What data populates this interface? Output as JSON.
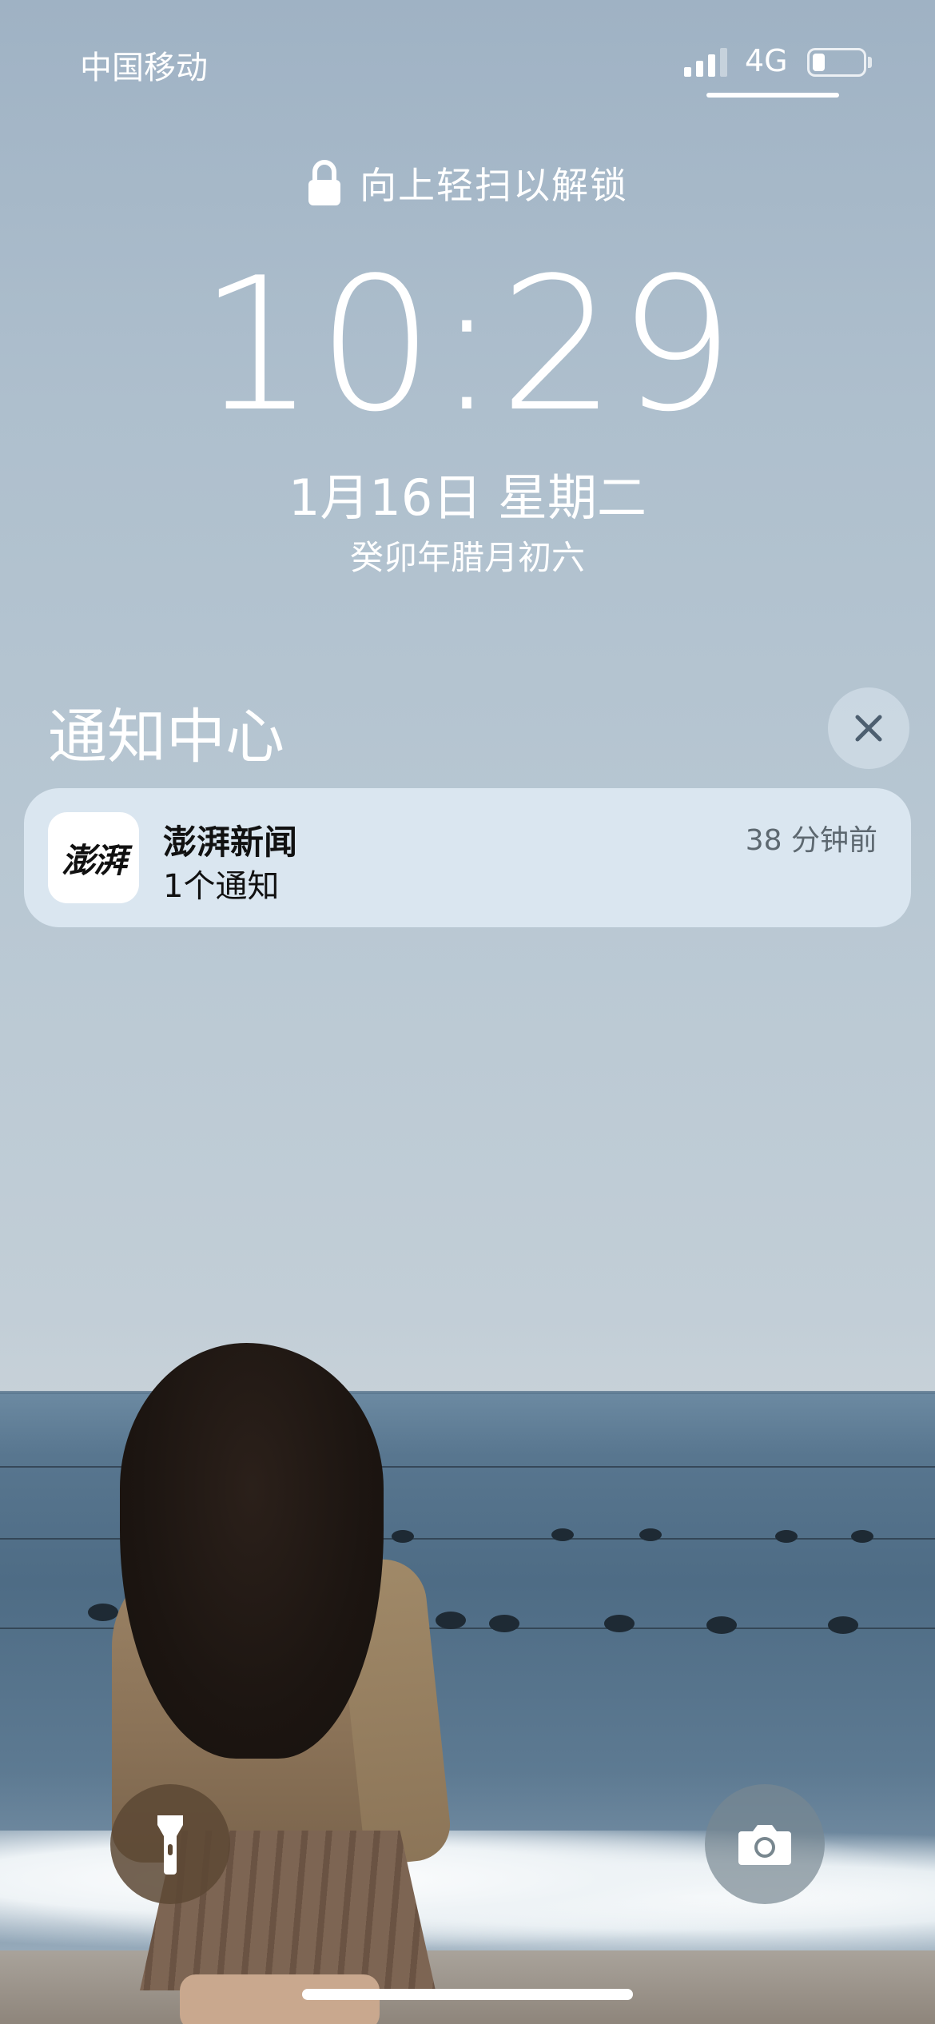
{
  "status_bar": {
    "carrier": "中国移动",
    "network": "4G",
    "signal_bars": 3,
    "signal_bars_total": 4,
    "battery_level": 0.25
  },
  "lock_screen": {
    "unlock_hint": "向上轻扫以解锁",
    "time": "10:29",
    "date": "1月16日 星期二",
    "lunar_date": "癸卯年腊月初六"
  },
  "notification_center": {
    "title": "通知中心",
    "close_icon": "close-icon",
    "notifications": [
      {
        "app_icon_text": "澎湃",
        "app_name": "澎湃新闻",
        "summary": "1个通知",
        "time": "38 分钟前"
      }
    ]
  },
  "controls": {
    "flashlight_icon": "flashlight-icon",
    "camera_icon": "camera-icon"
  },
  "colors": {
    "text": "#ffffff",
    "card_background": "#e2edf6",
    "flashlight_button": "#5c4834",
    "camera_button": "#78878f"
  }
}
